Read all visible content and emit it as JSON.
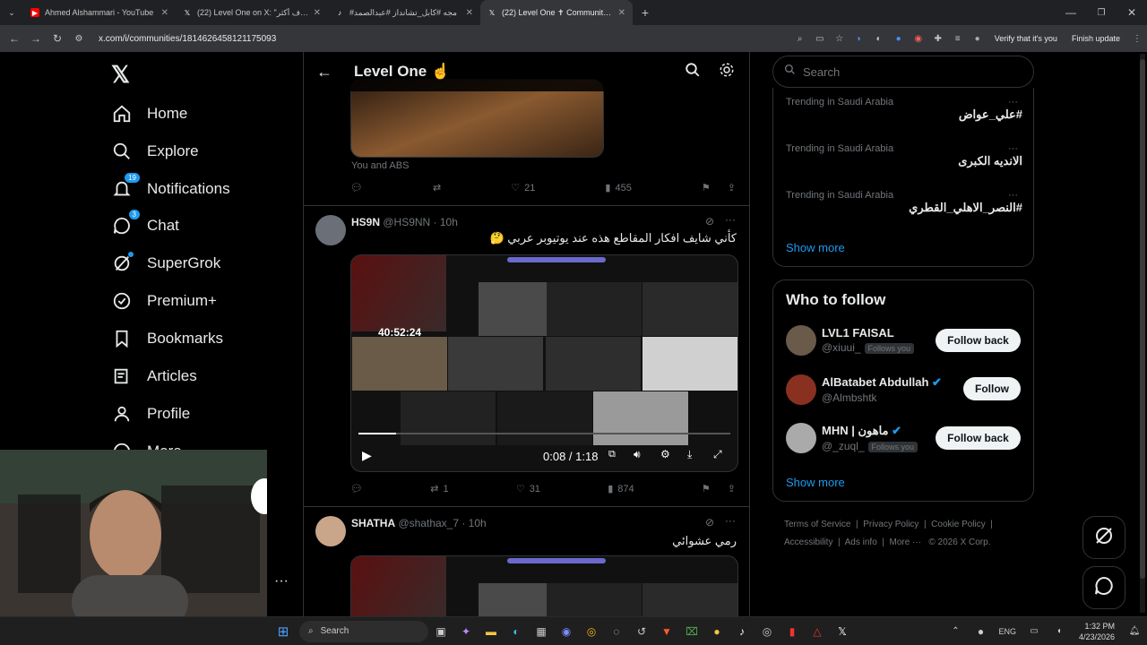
{
  "browser": {
    "tabs": [
      {
        "title": "Ahmed Alshammari - YouTube",
        "icon": "youtube-icon",
        "active": false
      },
      {
        "title": "(22) Level One on X: \"يهدف أكثر",
        "icon": "x-icon",
        "active": false
      },
      {
        "title": "#مجه #كابل_تشانداز #عبدالصمد",
        "icon": "tiktok-icon",
        "active": false
      },
      {
        "title": "(22) Level One ✝ Community / X",
        "icon": "x-icon",
        "active": true
      }
    ],
    "url": "x.com/i/communities/1814626458121175093",
    "verify_label": "Verify that it's you",
    "finish_update_label": "Finish update"
  },
  "nav": {
    "items": [
      {
        "label": "Home",
        "icon": "home-icon"
      },
      {
        "label": "Explore",
        "icon": "search-icon"
      },
      {
        "label": "Notifications",
        "icon": "bell-icon",
        "badge": "19"
      },
      {
        "label": "Chat",
        "icon": "chat-icon",
        "badge": "3"
      },
      {
        "label": "SuperGrok",
        "icon": "grok-icon"
      },
      {
        "label": "Premium+",
        "icon": "premium-icon"
      },
      {
        "label": "Bookmarks",
        "icon": "bookmark-icon"
      },
      {
        "label": "Articles",
        "icon": "articles-icon"
      },
      {
        "label": "Profile",
        "icon": "profile-icon"
      },
      {
        "label": "More",
        "icon": "more-icon"
      }
    ]
  },
  "header": {
    "title": "Level One ☝"
  },
  "posts": [
    {
      "liked_by": "You and ABS",
      "likes": "21",
      "views": "455"
    },
    {
      "name": "HS9N",
      "handle": "@HS9NN · 10h",
      "text": "كأني شايف افكار المقاطع هذه عند يوتيوبر عربي 🤔",
      "video_overlay_time": "40:52:24",
      "video_time": "0:08 / 1:18",
      "video_progress": 0.1,
      "retweets": "1",
      "likes": "31",
      "views": "874"
    },
    {
      "name": "SHATHA",
      "handle": "@shathax_7 · 10h",
      "text": "رمي عشوائي"
    }
  ],
  "search": {
    "placeholder": "Search"
  },
  "trends": {
    "items": [
      {
        "meta": "Trending in Saudi Arabia",
        "name": "#علي_عواض"
      },
      {
        "meta": "Trending in Saudi Arabia",
        "name": "الانديه الكبرى"
      },
      {
        "meta": "Trending in Saudi Arabia",
        "name": "#النصر_الاهلي_القطري"
      }
    ],
    "show_more": "Show more"
  },
  "who_to_follow": {
    "title": "Who to follow",
    "users": [
      {
        "name": "LVL1 FAISAL",
        "handle": "@xiuui_",
        "follows_you": "Follows you",
        "button": "Follow back",
        "verified": false
      },
      {
        "name": "AlBatabet Abdullah",
        "handle": "@Almbshtk",
        "follows_you": "",
        "button": "Follow",
        "verified": true
      },
      {
        "name": "MHN | ماهون",
        "handle": "@_zuql_",
        "follows_you": "Follows you",
        "button": "Follow back",
        "verified": true
      }
    ],
    "show_more": "Show more"
  },
  "footer": {
    "links": [
      "Terms of Service",
      "Privacy Policy",
      "Cookie Policy",
      "Accessibility",
      "Ads info",
      "More ···"
    ],
    "copyright": "© 2026 X Corp."
  },
  "taskbar": {
    "search_label": "Search",
    "lang": "ENG",
    "time": "1:32 PM",
    "date": "4/23/2026"
  },
  "colors": {
    "accent": "#1d9bf0",
    "bg": "#000000",
    "border": "#2f3336",
    "muted": "#71767b"
  }
}
